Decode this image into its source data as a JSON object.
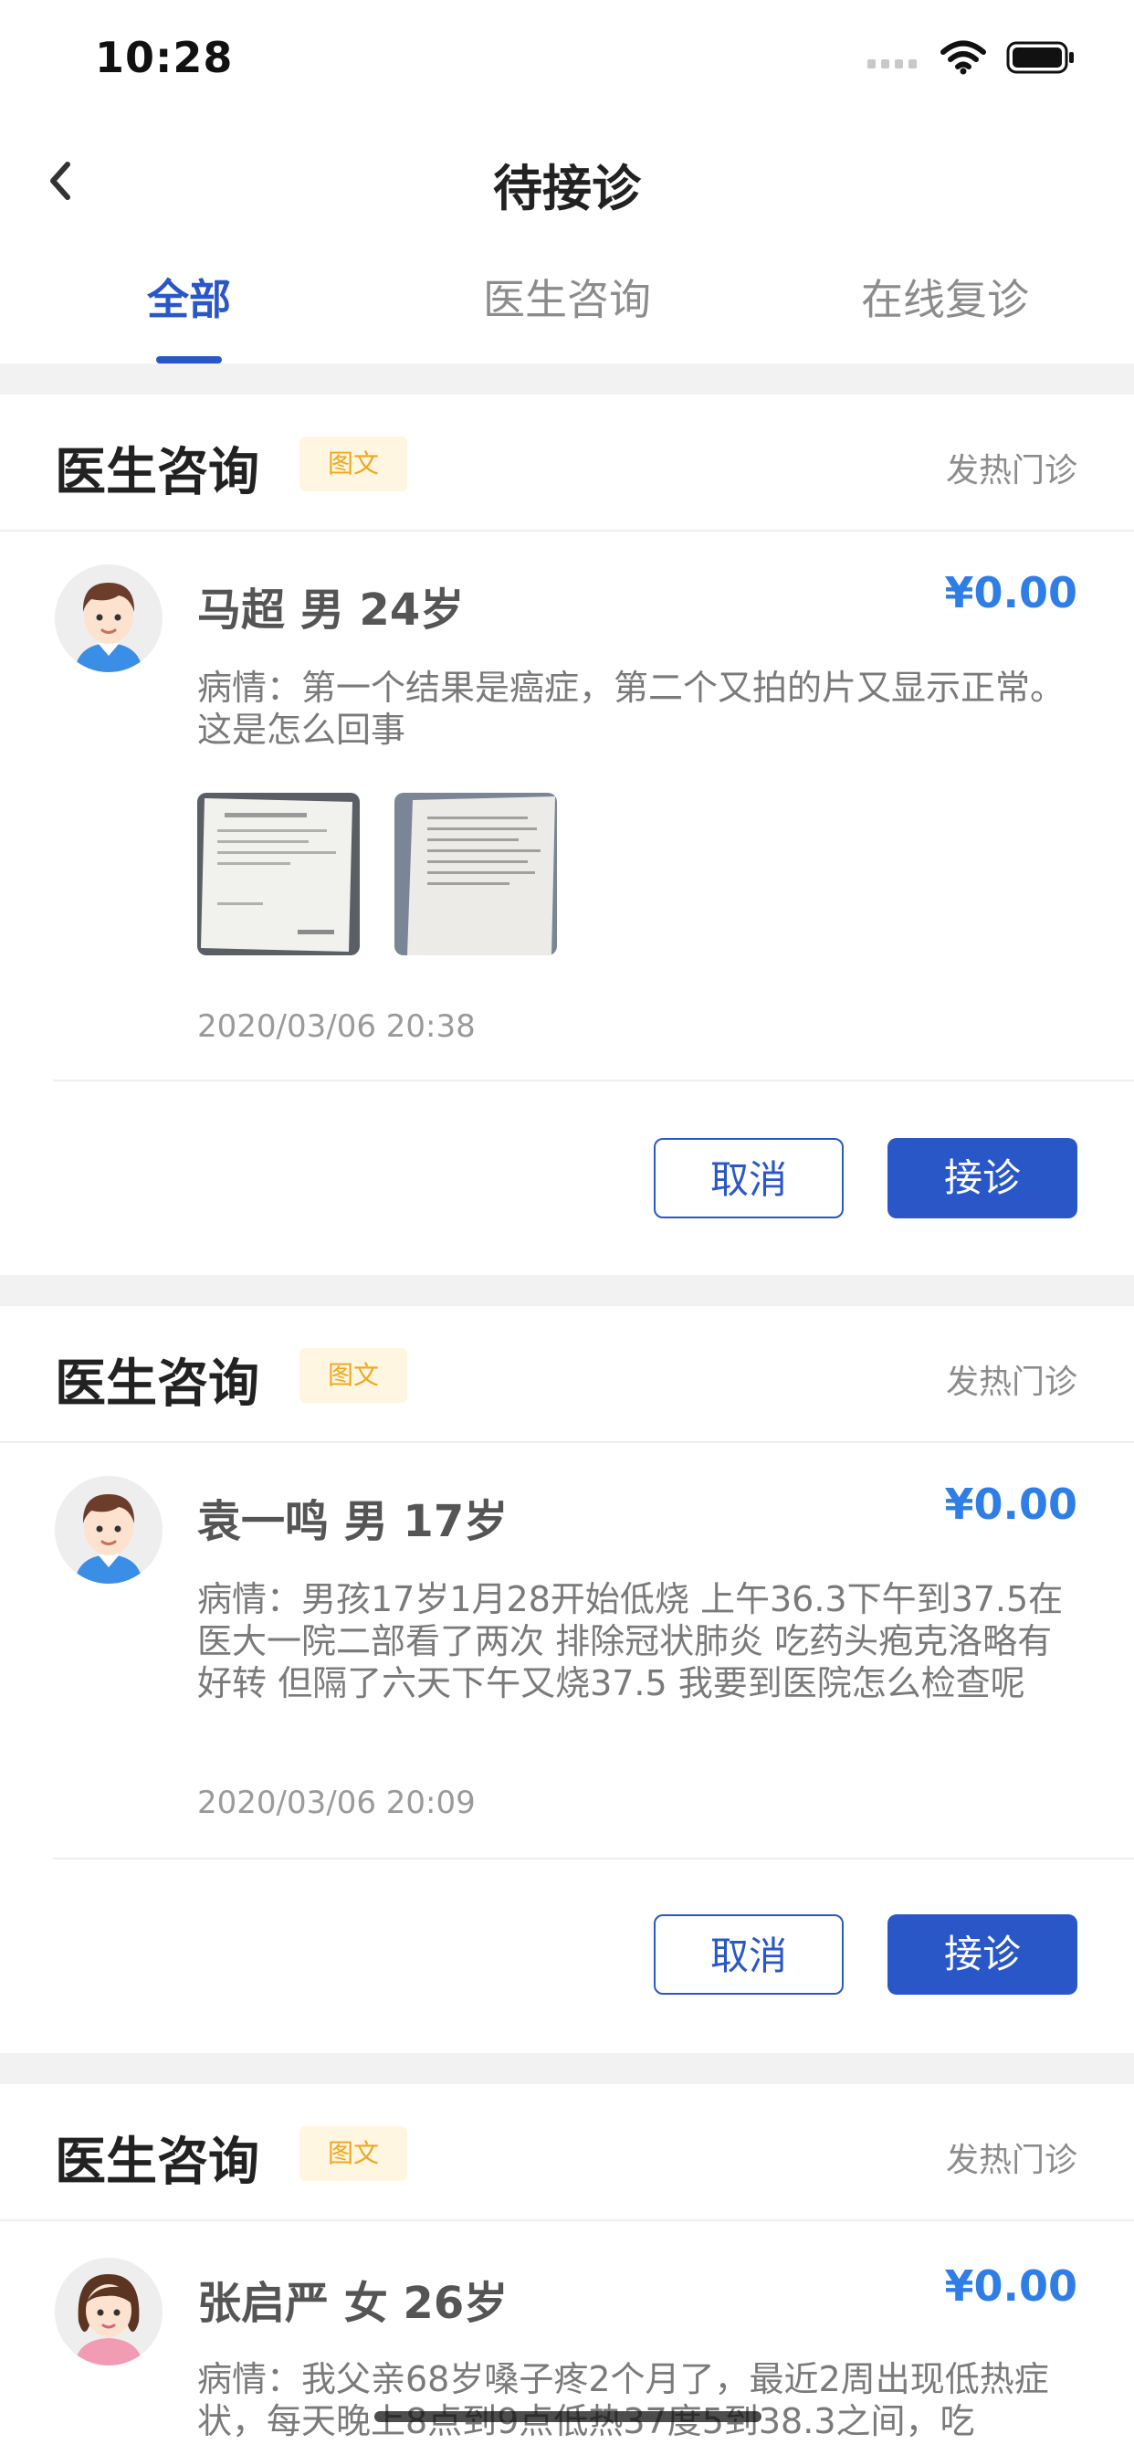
{
  "status_bar": {
    "time": "10:28"
  },
  "header": {
    "title": "待接诊"
  },
  "tabs": [
    {
      "label": "全部",
      "active": true
    },
    {
      "label": "医生咨询",
      "active": false
    },
    {
      "label": "在线复诊",
      "active": false
    }
  ],
  "cards": [
    {
      "type": "医生咨询",
      "tag": "图文",
      "department": "发热门诊",
      "patient": "马超 男 24岁",
      "price": "¥0.00",
      "condition": "病情：第一个结果是癌症，第二个又拍的片又显示正常。这是怎么回事",
      "date": "2020/03/06 20:38",
      "cancel_label": "取消",
      "accept_label": "接诊"
    },
    {
      "type": "医生咨询",
      "tag": "图文",
      "department": "发热门诊",
      "patient": "袁一鸣 男 17岁",
      "price": "¥0.00",
      "condition": "病情：男孩17岁1月28开始低烧 上午36.3下午到37.5在医大一院二部看了两次 排除冠状肺炎 吃药头疱克洛略有好转 但隔了六天下午又烧37.5 我要到医院怎么检查呢",
      "date": "2020/03/06 20:09",
      "cancel_label": "取消",
      "accept_label": "接诊"
    },
    {
      "type": "医生咨询",
      "tag": "图文",
      "department": "发热门诊",
      "patient": "张启严 女 26岁",
      "price": "¥0.00",
      "condition": "病情：我父亲68岁嗓子疼2个月了，最近2周出现低热症状，每天晚上8点到9点低热37度5到38.3之间，吃"
    }
  ],
  "colors": {
    "accent": "#2a57c8",
    "price": "#2f7ee6",
    "tag_bg": "#fff6e2",
    "tag_text": "#f0a61e"
  },
  "icons": [
    "signal-icon",
    "wifi-icon",
    "battery-icon",
    "back-chevron-icon",
    "male-avatar-icon",
    "female-avatar-icon"
  ]
}
